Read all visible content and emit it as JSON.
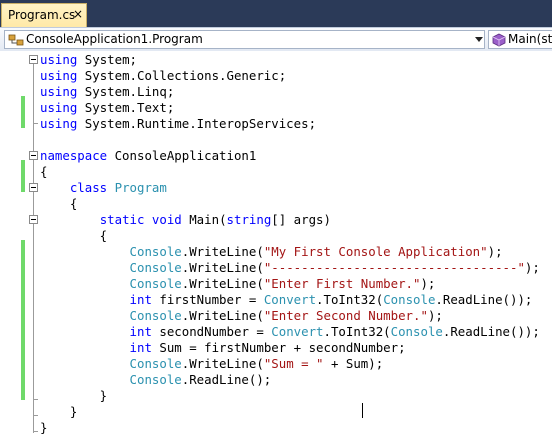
{
  "tab": {
    "title": "Program.cs",
    "close_glyph": "×"
  },
  "navbar": {
    "type_combo": {
      "value": "ConsoleApplication1.Program",
      "icon": "class-icon"
    },
    "member_combo": {
      "value": "Main(str",
      "icon": "method-icon"
    }
  },
  "editor": {
    "lines": [
      {
        "tokens": [
          {
            "t": "kw",
            "v": "using"
          },
          {
            "t": "pl",
            "v": " System;"
          }
        ]
      },
      {
        "tokens": [
          {
            "t": "kw",
            "v": "using"
          },
          {
            "t": "pl",
            "v": " System.Collections.Generic;"
          }
        ]
      },
      {
        "tokens": [
          {
            "t": "kw",
            "v": "using"
          },
          {
            "t": "pl",
            "v": " System.Linq;"
          }
        ]
      },
      {
        "tokens": [
          {
            "t": "kw",
            "v": "using"
          },
          {
            "t": "pl",
            "v": " System.Text;"
          }
        ]
      },
      {
        "tokens": [
          {
            "t": "kw",
            "v": "using"
          },
          {
            "t": "pl",
            "v": " System.Runtime.InteropServices;"
          }
        ]
      },
      {
        "tokens": []
      },
      {
        "tokens": [
          {
            "t": "kw",
            "v": "namespace"
          },
          {
            "t": "pl",
            "v": " ConsoleApplication1"
          }
        ]
      },
      {
        "tokens": [
          {
            "t": "pl",
            "v": "{"
          }
        ]
      },
      {
        "tokens": [
          {
            "t": "pl",
            "v": "    "
          },
          {
            "t": "kw",
            "v": "class"
          },
          {
            "t": "pl",
            "v": " "
          },
          {
            "t": "ty",
            "v": "Program"
          }
        ]
      },
      {
        "tokens": [
          {
            "t": "pl",
            "v": "    {"
          }
        ]
      },
      {
        "tokens": [
          {
            "t": "pl",
            "v": "        "
          },
          {
            "t": "kw",
            "v": "static"
          },
          {
            "t": "pl",
            "v": " "
          },
          {
            "t": "kw",
            "v": "void"
          },
          {
            "t": "pl",
            "v": " Main("
          },
          {
            "t": "kw",
            "v": "string"
          },
          {
            "t": "pl",
            "v": "[] args)"
          }
        ]
      },
      {
        "tokens": [
          {
            "t": "pl",
            "v": "        {"
          }
        ]
      },
      {
        "tokens": [
          {
            "t": "pl",
            "v": "            "
          },
          {
            "t": "ty",
            "v": "Console"
          },
          {
            "t": "pl",
            "v": ".WriteLine("
          },
          {
            "t": "st",
            "v": "\"My First Console Application\""
          },
          {
            "t": "pl",
            "v": ");"
          }
        ]
      },
      {
        "tokens": [
          {
            "t": "pl",
            "v": "            "
          },
          {
            "t": "ty",
            "v": "Console"
          },
          {
            "t": "pl",
            "v": ".WriteLine("
          },
          {
            "t": "st",
            "v": "\"---------------------------------\""
          },
          {
            "t": "pl",
            "v": ");"
          }
        ]
      },
      {
        "tokens": [
          {
            "t": "pl",
            "v": "            "
          },
          {
            "t": "ty",
            "v": "Console"
          },
          {
            "t": "pl",
            "v": ".WriteLine("
          },
          {
            "t": "st",
            "v": "\"Enter First Number.\""
          },
          {
            "t": "pl",
            "v": ");"
          }
        ]
      },
      {
        "tokens": [
          {
            "t": "pl",
            "v": "            "
          },
          {
            "t": "kw",
            "v": "int"
          },
          {
            "t": "pl",
            "v": " firstNumber = "
          },
          {
            "t": "ty",
            "v": "Convert"
          },
          {
            "t": "pl",
            "v": ".ToInt32("
          },
          {
            "t": "ty",
            "v": "Console"
          },
          {
            "t": "pl",
            "v": ".ReadLine());"
          }
        ]
      },
      {
        "tokens": [
          {
            "t": "pl",
            "v": "            "
          },
          {
            "t": "ty",
            "v": "Console"
          },
          {
            "t": "pl",
            "v": ".WriteLine("
          },
          {
            "t": "st",
            "v": "\"Enter Second Number.\""
          },
          {
            "t": "pl",
            "v": ");"
          }
        ]
      },
      {
        "tokens": [
          {
            "t": "pl",
            "v": "            "
          },
          {
            "t": "kw",
            "v": "int"
          },
          {
            "t": "pl",
            "v": " secondNumber = "
          },
          {
            "t": "ty",
            "v": "Convert"
          },
          {
            "t": "pl",
            "v": ".ToInt32("
          },
          {
            "t": "ty",
            "v": "Console"
          },
          {
            "t": "pl",
            "v": ".ReadLine());"
          }
        ]
      },
      {
        "tokens": [
          {
            "t": "pl",
            "v": "            "
          },
          {
            "t": "kw",
            "v": "int"
          },
          {
            "t": "pl",
            "v": " Sum = firstNumber + secondNumber;"
          }
        ]
      },
      {
        "tokens": [
          {
            "t": "pl",
            "v": "            "
          },
          {
            "t": "ty",
            "v": "Console"
          },
          {
            "t": "pl",
            "v": ".WriteLine("
          },
          {
            "t": "st",
            "v": "\"Sum = \""
          },
          {
            "t": "pl",
            "v": " + Sum);"
          }
        ]
      },
      {
        "tokens": [
          {
            "t": "pl",
            "v": "            "
          },
          {
            "t": "ty",
            "v": "Console"
          },
          {
            "t": "pl",
            "v": ".ReadLine();"
          }
        ]
      },
      {
        "tokens": [
          {
            "t": "pl",
            "v": "        }"
          }
        ]
      },
      {
        "tokens": [
          {
            "t": "pl",
            "v": "    }"
          }
        ]
      },
      {
        "tokens": [
          {
            "t": "pl",
            "v": "}"
          }
        ]
      }
    ],
    "colors": {
      "keyword": "#0000ff",
      "type": "#2b91af",
      "string": "#a31515",
      "changed_marker": "#6fd96a"
    }
  }
}
